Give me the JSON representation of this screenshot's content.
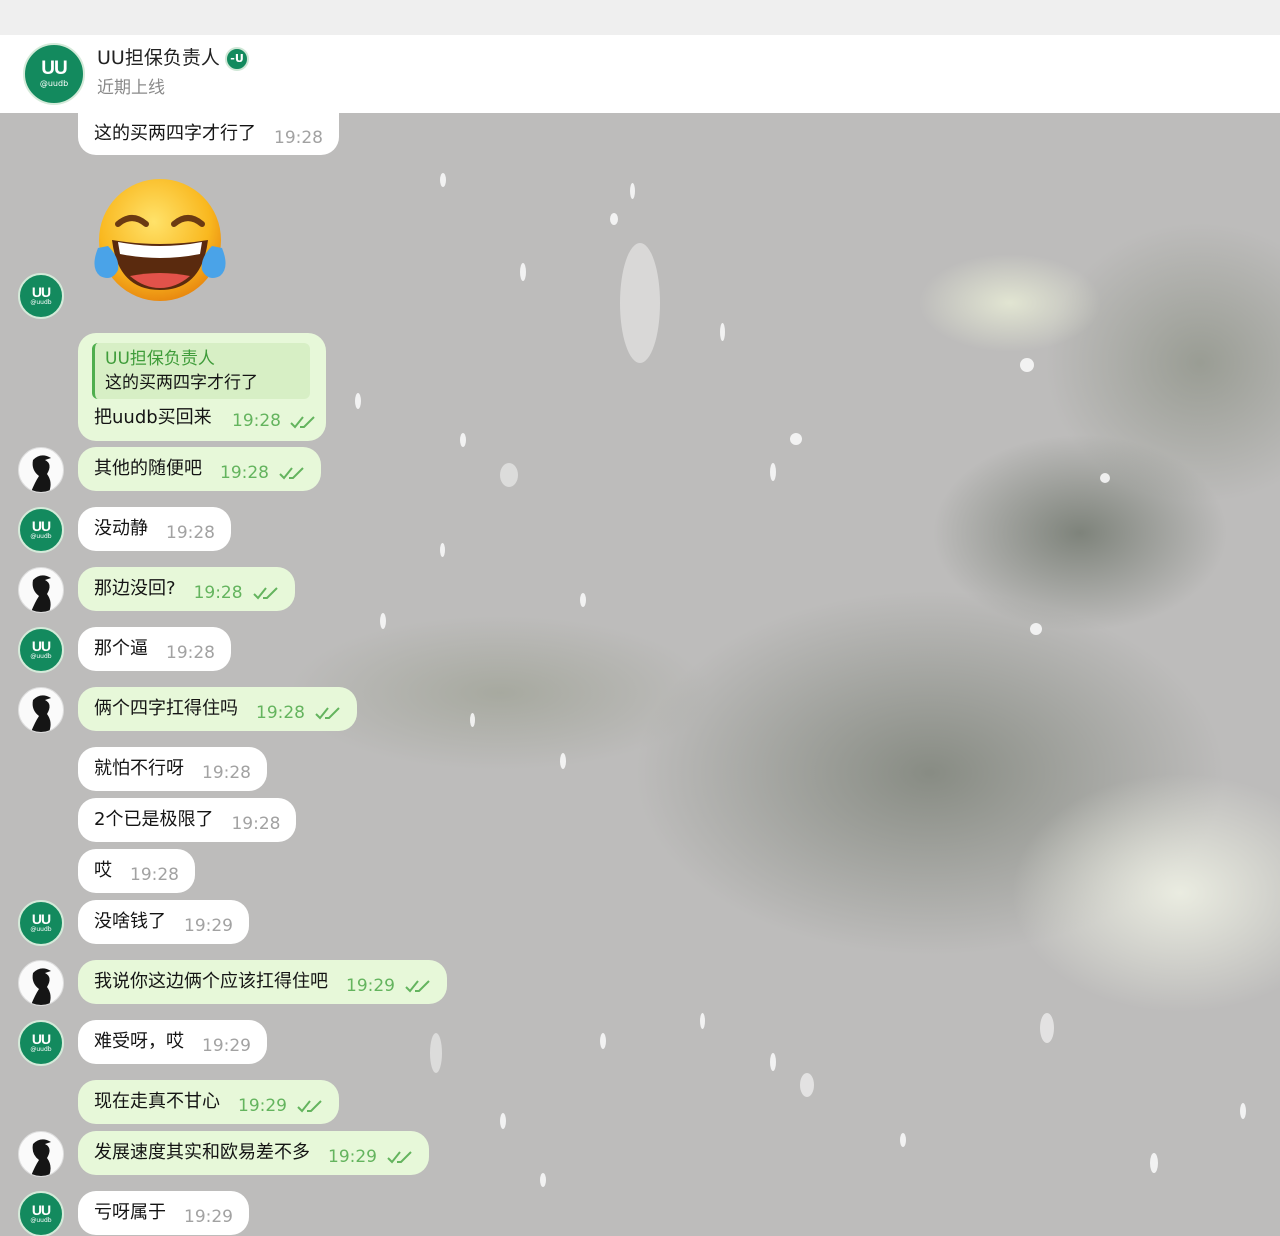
{
  "header": {
    "title": "UU担保负责人",
    "badge": "-U",
    "status": "近期上线",
    "avatar_logo": "UU",
    "avatar_handle": "@uudb"
  },
  "colors": {
    "brand_green": "#138a5e",
    "outgoing_bubble": "#e7f8d9",
    "incoming_bubble": "#ffffff",
    "read_check": "#64b45e"
  },
  "chat": {
    "reply": {
      "quote_name": "UU担保负责人",
      "quote_text": "这的买两四字才行了",
      "text": "把uudb买回来",
      "time": "19:28"
    },
    "messages": [
      {
        "text": "这的买两四字才行了",
        "time": "19:28"
      },
      {
        "text": "😂",
        "time": ""
      },
      {
        "text": "其他的随便吧",
        "time": "19:28"
      },
      {
        "text": "没动静",
        "time": "19:28"
      },
      {
        "text": "那边没回?",
        "time": "19:28"
      },
      {
        "text": "那个逼",
        "time": "19:28"
      },
      {
        "text": "俩个四字扛得住吗",
        "time": "19:28"
      },
      {
        "text": "就怕不行呀",
        "time": "19:28"
      },
      {
        "text": "2个已是极限了",
        "time": "19:28"
      },
      {
        "text": "哎",
        "time": "19:28"
      },
      {
        "text": "没啥钱了",
        "time": "19:29"
      },
      {
        "text": "我说你这边俩个应该扛得住吧",
        "time": "19:29"
      },
      {
        "text": "难受呀，哎",
        "time": "19:29"
      },
      {
        "text": "现在走真不甘心",
        "time": "19:29"
      },
      {
        "text": "发展速度其实和欧易差不多",
        "time": "19:29"
      },
      {
        "text": "亏呀属于",
        "time": "19:29"
      }
    ]
  }
}
